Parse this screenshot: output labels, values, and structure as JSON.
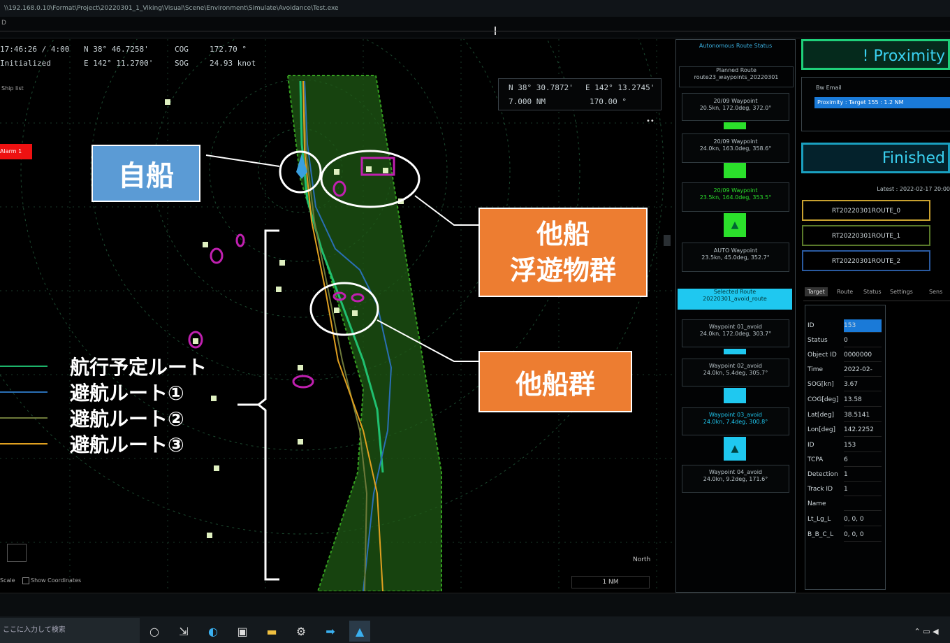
{
  "window": {
    "title": "\\\\192.168.0.10\\Format\\Project\\20220301_1_Viking\\Visual\\Scene\\Environment\\Simulate\\Avoidance\\Test.exe",
    "tabs_text": "D"
  },
  "header": {
    "time": "17:46:26 / 4:00",
    "status": "Initialized",
    "lat": "N 38° 46.7258'",
    "lon": "E 142° 11.2700'",
    "cog_label": "COG",
    "cog_value": "172.70 °",
    "sog_label": "SOG",
    "sog_value": "24.93 knot"
  },
  "radar": {
    "left_label": "Ship list",
    "alarm_label": "Alarm 1",
    "cursor_lat": "N 38° 30.7872'",
    "cursor_lon": "E 142° 13.2745'",
    "cursor_range": "7.000 NM",
    "cursor_bearing": "170.00 °",
    "north_label": "North",
    "scale_label": "1 NM",
    "bottom_left": "Scale",
    "bottom_check": "Show Coordinates",
    "corner_btn": "••"
  },
  "callouts": {
    "own_ship": "自船",
    "other_ships_floating_line1": "他船",
    "other_ships_floating_line2": "浮遊物群",
    "other_ship_group": "他船群"
  },
  "legend": {
    "items": [
      {
        "label": "航行予定ルート",
        "color": "#1db36a"
      },
      {
        "label": "避航ルート①",
        "color": "#2a6fb5"
      },
      {
        "label": "避航ルート②",
        "color": "#6e7a3a"
      },
      {
        "label": "避航ルート③",
        "color": "#e0a020"
      }
    ]
  },
  "mid_panel": {
    "header1": "Autonomous Route Status",
    "header2": "Planned Route",
    "header3": "route23_waypoints_20220301",
    "cards_top": [
      {
        "name": "20/09 Waypoint",
        "detail": "20.5kn, 172.0deg, 372.0°"
      },
      {
        "name": "20/09 Waypoint",
        "detail": "24.0kn, 163.0deg, 358.6°"
      },
      {
        "name": "20/09 Waypoint",
        "detail": "23.5kn, 164.0deg, 353.5°"
      },
      {
        "name": "AUTO Waypoint",
        "detail": "23.5kn, 45.0deg, 352.7°"
      }
    ],
    "selected_header1": "Selected Route",
    "selected_header2": "20220301_avoid_route",
    "cards_bottom": [
      {
        "name": "Waypoint 01_avoid",
        "detail": "24.0kn, 172.0deg, 303.7°"
      },
      {
        "name": "Waypoint 02_avoid",
        "detail": "24.0kn, 5.4deg, 305.7°"
      },
      {
        "name": "Waypoint 03_avoid",
        "detail": "24.0kn, 7.4deg, 300.8°"
      },
      {
        "name": "Waypoint 04_avoid",
        "detail": "24.0kn, 9.2deg, 171.6°"
      }
    ]
  },
  "right_panel": {
    "proximity": "! Proximity",
    "list_title": "Bw Email",
    "list_item": "Proximity : Target 155 : 1.2 NM",
    "finished": "Finished",
    "latest": "Latest : 2022-02-17 20:00",
    "routes": [
      {
        "name": "RT20220301ROUTE_0",
        "color": "#c9a230"
      },
      {
        "name": "RT20220301ROUTE_1",
        "color": "#5a7a2a"
      },
      {
        "name": "RT20220301ROUTE_2",
        "color": "#2a5aa0"
      }
    ],
    "tabs": [
      "Target",
      "Route",
      "Status",
      "Settings",
      "Sens"
    ],
    "fields": [
      {
        "label": "ID",
        "value": "153"
      },
      {
        "label": "Status",
        "value": "0"
      },
      {
        "label": "Object ID",
        "value": "0000000"
      },
      {
        "label": "Time",
        "value": "2022-02-"
      },
      {
        "label": "SOG[kn]",
        "value": "3.67"
      },
      {
        "label": "COG[deg]",
        "value": "13.58"
      },
      {
        "label": "Lat[deg]",
        "value": "38.5141"
      },
      {
        "label": "Lon[deg]",
        "value": "142.2252"
      },
      {
        "label": "ID",
        "value": "153"
      },
      {
        "label": "TCPA",
        "value": "6"
      },
      {
        "label": "Detection",
        "value": "1"
      },
      {
        "label": "Track ID",
        "value": "1"
      },
      {
        "label": "Name",
        "value": ""
      },
      {
        "label": "Lt_Lg_L",
        "value": "0, 0, 0"
      },
      {
        "label": "B_B_C_L",
        "value": "0, 0, 0"
      }
    ]
  },
  "taskbar": {
    "search": "ここに入力して検索",
    "icons": [
      "task-view-icon",
      "widget-icon",
      "edge-icon",
      "store-icon",
      "explorer-icon",
      "settings-icon",
      "mail-icon",
      "app-icon"
    ]
  }
}
